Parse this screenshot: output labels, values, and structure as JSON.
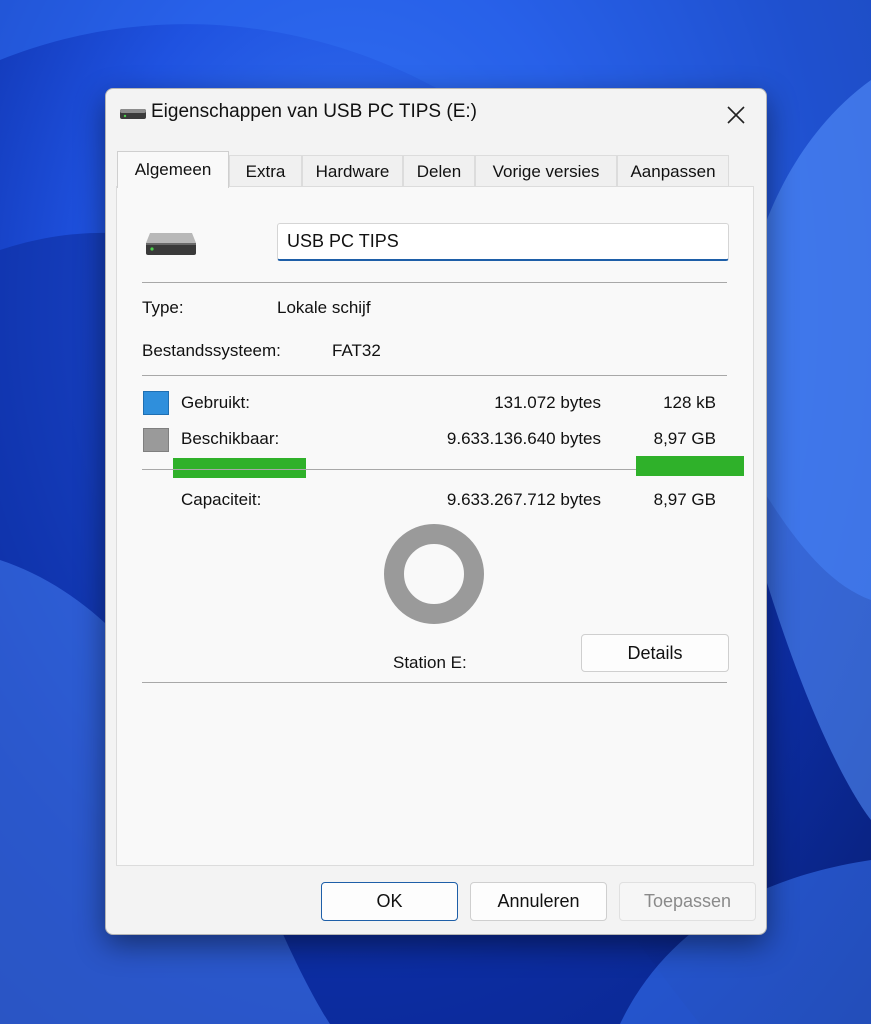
{
  "window": {
    "title": "Eigenschappen van USB PC TIPS (E:)",
    "icon": "drive-icon",
    "close_icon": "close-icon"
  },
  "tabs": [
    {
      "label": "Algemeen",
      "active": true
    },
    {
      "label": "Extra",
      "active": false
    },
    {
      "label": "Hardware",
      "active": false
    },
    {
      "label": "Delen",
      "active": false
    },
    {
      "label": "Vorige versies",
      "active": false
    },
    {
      "label": "Aanpassen",
      "active": false
    }
  ],
  "general": {
    "drive_name_value": "USB PC TIPS",
    "type_label": "Type:",
    "type_value": "Lokale schijf",
    "fs_label": "Bestandssysteem:",
    "fs_value": "FAT32",
    "used": {
      "label": "Gebruikt:",
      "bytes": "131.072 bytes",
      "size": "128 kB",
      "color": "#2f8fdc"
    },
    "free": {
      "label": "Beschikbaar:",
      "bytes": "9.633.136.640 bytes",
      "size": "8,97 GB",
      "color": "#9a9a9a"
    },
    "capacity": {
      "label": "Capaciteit:",
      "bytes": "9.633.267.712 bytes",
      "size": "8,97 GB"
    },
    "used_fraction": 1.36e-05,
    "station_label": "Station E:",
    "details_label": "Details"
  },
  "buttons": {
    "ok": "OK",
    "cancel": "Annuleren",
    "apply": "Toepassen"
  },
  "colors": {
    "accent": "#1e5fa8",
    "used": "#2f8fdc",
    "free": "#9a9a9a",
    "highlight": "#2fb12a"
  }
}
